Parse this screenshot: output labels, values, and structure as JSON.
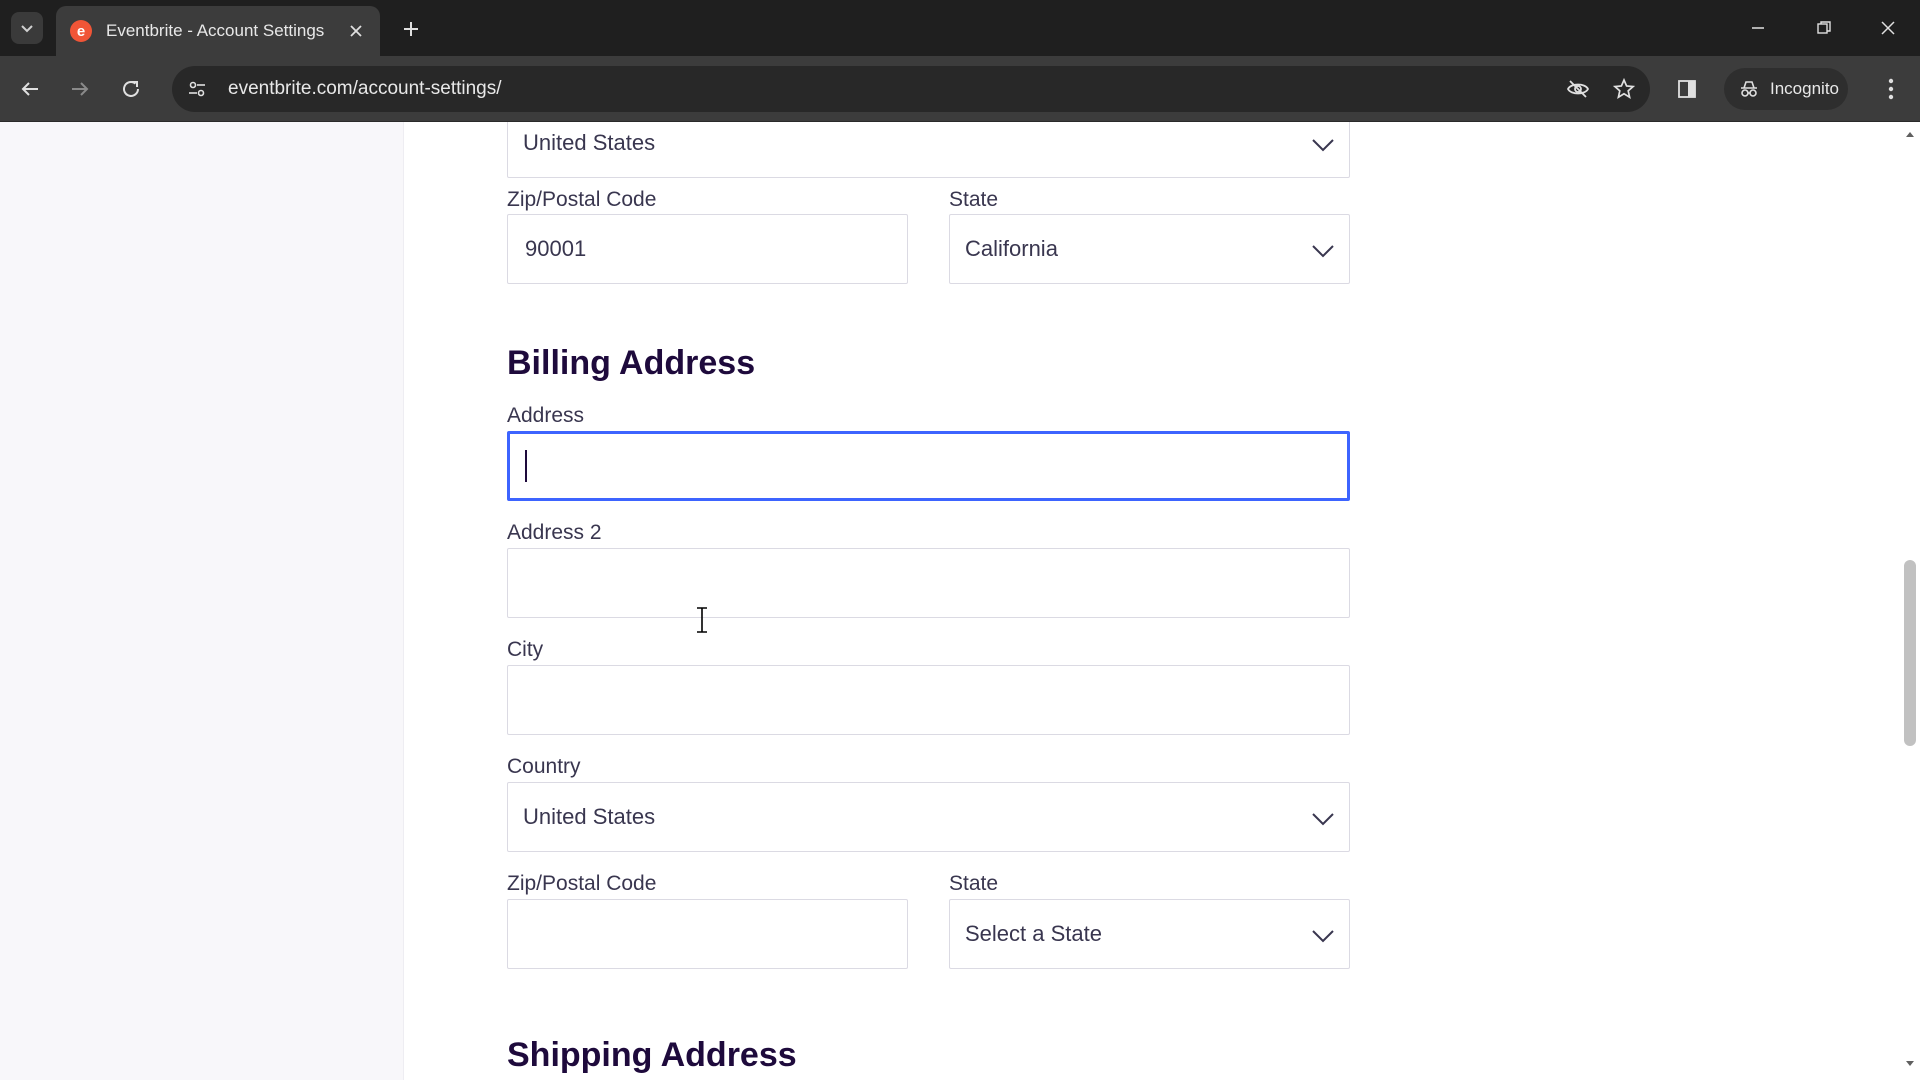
{
  "browser": {
    "tab_title": "Eventbrite - Account Settings",
    "url": "eventbrite.com/account-settings/",
    "incognito_label": "Incognito",
    "accent_favicon": "#f05537"
  },
  "home_address_partial": {
    "country_value": "United States",
    "zip_label": "Zip/Postal Code",
    "zip_value": "90001",
    "state_label": "State",
    "state_value": "California"
  },
  "billing": {
    "title": "Billing Address",
    "address_label": "Address",
    "address_value": "",
    "address2_label": "Address 2",
    "address2_value": "",
    "city_label": "City",
    "city_value": "",
    "country_label": "Country",
    "country_value": "United States",
    "zip_label": "Zip/Postal Code",
    "zip_value": "",
    "state_label": "State",
    "state_value": "Select a State"
  },
  "shipping": {
    "title": "Shipping Address"
  },
  "colors": {
    "focus_border": "#3d64ff",
    "heading": "#1e0a3c",
    "text": "#39364f"
  }
}
